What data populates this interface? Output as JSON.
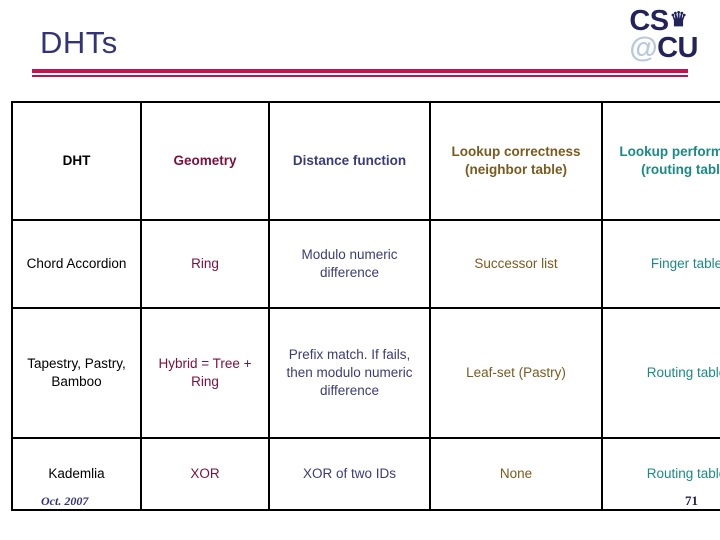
{
  "slide": {
    "title": "DHTs",
    "title_color": "#33337a",
    "rule_color": "#c8104f"
  },
  "logo": {
    "name": "cs-at-cu-logo",
    "line1_main": "CS",
    "crown_icon": "♛",
    "line2_at": "@",
    "line2_main": "CU",
    "color_dark": "#23235c",
    "color_light": "#b9c8dd"
  },
  "table": {
    "headers": [
      {
        "label": "DHT",
        "color": "#000000"
      },
      {
        "label": "Geometry",
        "color": "#7b0f3d"
      },
      {
        "label": "Distance function",
        "color": "#3b3b7a"
      },
      {
        "label": "Lookup correctness (neighbor table)",
        "color": "#7a5a1e"
      },
      {
        "label": "Lookup performance (routing table)",
        "color": "#1b8a86"
      }
    ],
    "rows": [
      {
        "dht": "Chord Accordion",
        "geometry": "Ring",
        "distance_function": "Modulo numeric difference",
        "lookup_correctness": "Successor list",
        "lookup_performance": "Finger table"
      },
      {
        "dht": "Tapestry, Pastry, Bamboo",
        "geometry": "Hybrid = Tree + Ring",
        "distance_function": "Prefix match. If fails, then modulo numeric difference",
        "lookup_correctness": "Leaf-set (Pastry)",
        "lookup_performance": "Routing table"
      },
      {
        "dht": "Kademlia",
        "geometry": "XOR",
        "distance_function": "XOR of two IDs",
        "lookup_correctness": "None",
        "lookup_performance": "Routing table"
      }
    ]
  },
  "footer": {
    "date": "Oct. 2007",
    "page_number": "71"
  }
}
